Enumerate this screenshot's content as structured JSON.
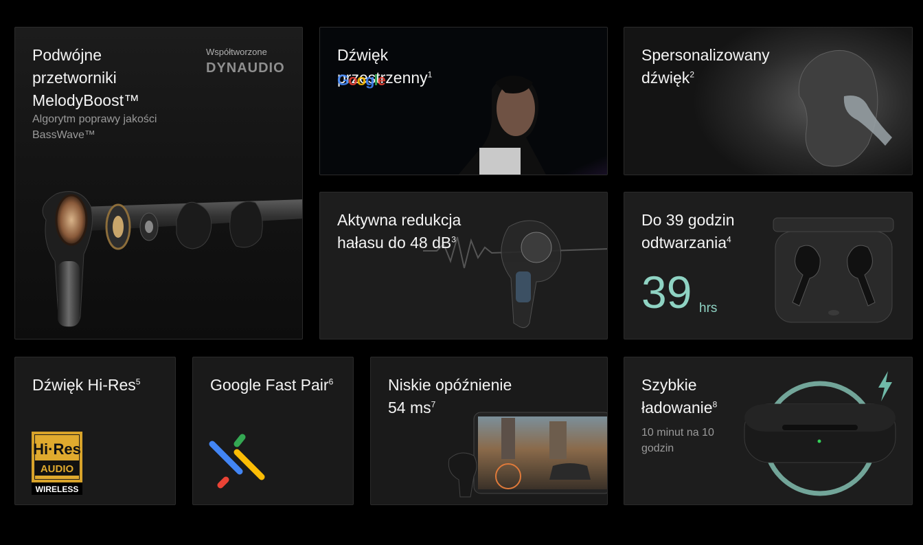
{
  "cards": {
    "drivers": {
      "title": [
        "Podwójne",
        "przetworniki",
        "MelodyBoost™"
      ],
      "subtitle": [
        "Algorytm poprawy jakości",
        "BassWave™"
      ],
      "cobrand_label": "Współtworzone",
      "cobrand_logo": "DYNAUDIO"
    },
    "spatial": {
      "title_line1": "Dźwięk",
      "title_line2": "przestrzenny",
      "sup": "1",
      "logo_text": "Google"
    },
    "personalized": {
      "title_line1": "Spersonalizowany",
      "title_line2": "dźwięk",
      "sup": "2"
    },
    "anc": {
      "title_line1": "Aktywna redukcja",
      "title_line2": "hałasu do 48 dB",
      "sup": "3"
    },
    "battery": {
      "title_line1": "Do 39 godzin",
      "title_line2": "odtwarzania",
      "sup": "4",
      "value": "39",
      "unit": "hrs"
    },
    "hires": {
      "title": "Dźwięk Hi-Res",
      "sup": "5",
      "badge_top": "Hi·Res",
      "badge_mid": "AUDIO",
      "badge_bottom": "WIRELESS"
    },
    "fastpair": {
      "title": "Google Fast Pair",
      "sup": "6"
    },
    "latency": {
      "title_line1": "Niskie opóźnienie",
      "title_line2": "54 ms",
      "sup": "7"
    },
    "charging": {
      "title_line1": "Szybkie",
      "title_line2": "ładowanie",
      "sup": "8",
      "subtitle": [
        "10 minut na 10",
        "godzin"
      ]
    }
  },
  "colors": {
    "accent_teal": "#8fd3c3",
    "card_bg": "#1a1a1a",
    "page_bg": "#000000",
    "hires_gold": "#d8a32a"
  },
  "icons": [
    "lightning-icon",
    "google-fast-pair-icon",
    "hi-res-audio-badge"
  ]
}
